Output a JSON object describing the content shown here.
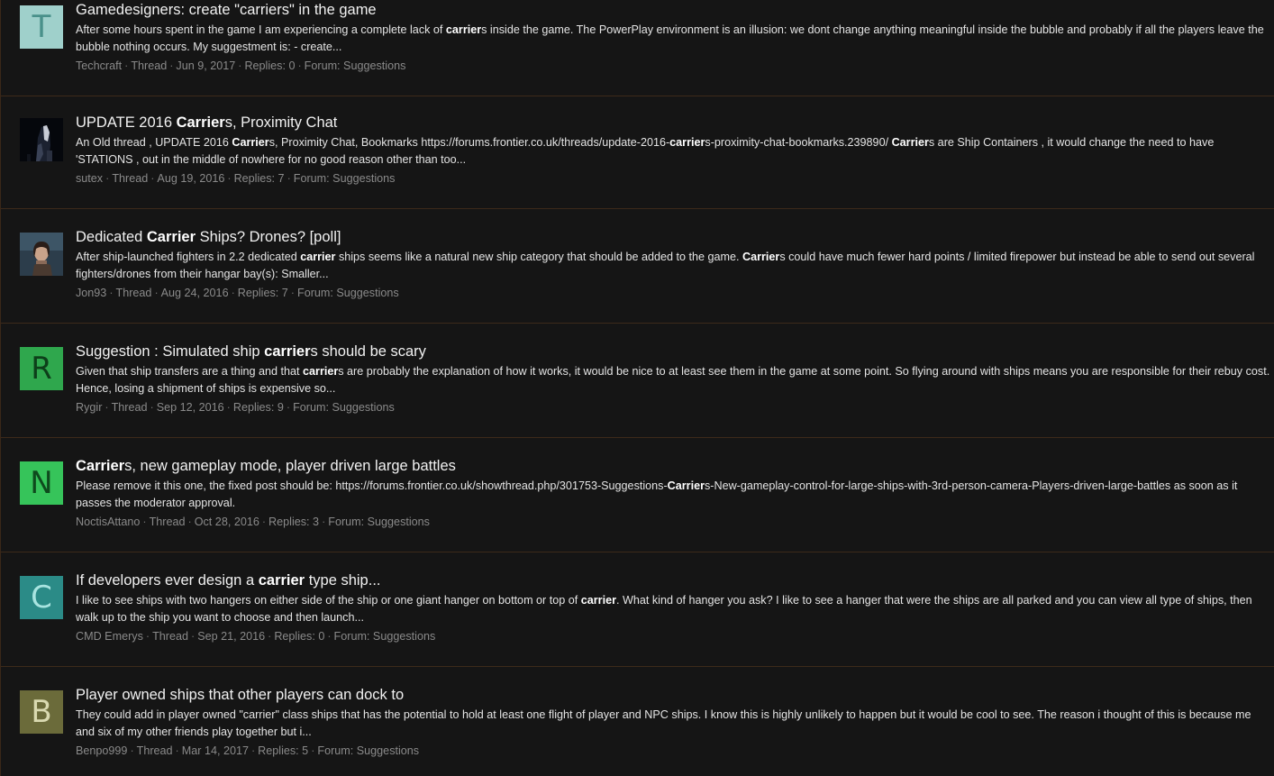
{
  "results": [
    {
      "avatar": {
        "type": "letter",
        "letter": "T",
        "bg": "#9fd0cb",
        "fg": "#49908a"
      },
      "title": [
        {
          "t": "Gamedesigners: create \"carriers\" in the game",
          "b": false
        }
      ],
      "snippet": [
        {
          "t": "After some hours spent in the game I am experiencing a complete lack of ",
          "b": false
        },
        {
          "t": "carrier",
          "b": true
        },
        {
          "t": "s inside the game. The PowerPlay environment is an illusion: we dont change anything meaningful inside the bubble and probably if all the players leave the bubble nothing occurs. My suggestment is: - create...",
          "b": false
        }
      ],
      "author": "Techcraft",
      "type": "Thread",
      "date": "Jun 9, 2017",
      "replies": "Replies: 0",
      "forum": "Forum: Suggestions"
    },
    {
      "avatar": {
        "type": "image",
        "name": "sutex-avatar",
        "bg": "#05070c"
      },
      "title": [
        {
          "t": "UPDATE 2016 ",
          "b": false
        },
        {
          "t": "Carrier",
          "b": true
        },
        {
          "t": "s, Proximity Chat",
          "b": false
        }
      ],
      "snippet": [
        {
          "t": "An Old thread , UPDATE 2016 ",
          "b": false
        },
        {
          "t": "Carrier",
          "b": true
        },
        {
          "t": "s, Proximity Chat, Bookmarks https://forums.frontier.co.uk/threads/update-2016-",
          "b": false
        },
        {
          "t": "carrier",
          "b": true
        },
        {
          "t": "s-proximity-chat-bookmarks.239890/ ",
          "b": false
        },
        {
          "t": "Carrier",
          "b": true
        },
        {
          "t": "s are Ship Containers , it would change the need to have 'STATIONS , out in the middle of nowhere for no good reason other than too...",
          "b": false
        }
      ],
      "author": "sutex",
      "type": "Thread",
      "date": "Aug 19, 2016",
      "replies": "Replies: 7",
      "forum": "Forum: Suggestions"
    },
    {
      "avatar": {
        "type": "image",
        "name": "jon93-avatar",
        "bg": "#2c3d4b"
      },
      "title": [
        {
          "t": "Dedicated ",
          "b": false
        },
        {
          "t": "Carrier",
          "b": true
        },
        {
          "t": " Ships? Drones? [poll]",
          "b": false
        }
      ],
      "snippet": [
        {
          "t": "After ship-launched fighters in 2.2 dedicated ",
          "b": false
        },
        {
          "t": "carrier",
          "b": true
        },
        {
          "t": " ships seems like a natural new ship category that should be added to the game. ",
          "b": false
        },
        {
          "t": "Carrier",
          "b": true
        },
        {
          "t": "s could have much fewer hard points / limited firepower but instead be able to send out several fighters/drones from their hangar bay(s): Smaller...",
          "b": false
        }
      ],
      "author": "Jon93",
      "type": "Thread",
      "date": "Aug 24, 2016",
      "replies": "Replies: 7",
      "forum": "Forum: Suggestions"
    },
    {
      "avatar": {
        "type": "letter",
        "letter": "R",
        "bg": "#2fa74d",
        "fg": "#0d3f1a"
      },
      "title": [
        {
          "t": "Suggestion : Simulated ship ",
          "b": false
        },
        {
          "t": "carrier",
          "b": true
        },
        {
          "t": "s should be scary",
          "b": false
        }
      ],
      "snippet": [
        {
          "t": "Given that ship transfers are a thing and that ",
          "b": false
        },
        {
          "t": "carrier",
          "b": true
        },
        {
          "t": "s are probably the explanation of how it works, it would be nice to at least see them in the game at some point. So flying around with ships means you are responsible for their rebuy cost. Hence, losing a shipment of ships is expensive so...",
          "b": false
        }
      ],
      "author": "Rygir",
      "type": "Thread",
      "date": "Sep 12, 2016",
      "replies": "Replies: 9",
      "forum": "Forum: Suggestions"
    },
    {
      "avatar": {
        "type": "letter",
        "letter": "N",
        "bg": "#36c45a",
        "fg": "#0e4a1d"
      },
      "title": [
        {
          "t": "Carrier",
          "b": true
        },
        {
          "t": "s, new gameplay mode, player driven large battles",
          "b": false
        }
      ],
      "snippet": [
        {
          "t": "Please remove it this one, the fixed post should be: https://forums.frontier.co.uk/showthread.php/301753-Suggestions-",
          "b": false
        },
        {
          "t": "Carrier",
          "b": true
        },
        {
          "t": "s-New-gameplay-control-for-large-ships-with-3rd-person-camera-Players-driven-large-battles as soon as it passes the moderator approval.",
          "b": false
        }
      ],
      "author": "NoctisAttano",
      "type": "Thread",
      "date": "Oct 28, 2016",
      "replies": "Replies: 3",
      "forum": "Forum: Suggestions"
    },
    {
      "avatar": {
        "type": "letter",
        "letter": "C",
        "bg": "#2b8b87",
        "fg": "#a8e4e0"
      },
      "title": [
        {
          "t": "If developers ever design a ",
          "b": false
        },
        {
          "t": "carrier",
          "b": true
        },
        {
          "t": " type ship...",
          "b": false
        }
      ],
      "snippet": [
        {
          "t": "I like to see ships with two hangers on either side of the ship or one giant hanger on bottom or top of ",
          "b": false
        },
        {
          "t": "carrier",
          "b": true
        },
        {
          "t": ". What kind of hanger you ask? I like to see a hanger that were the ships are all parked and you can view all type of ships, then walk up to the ship you want to choose and then launch...",
          "b": false
        }
      ],
      "author": "CMD Emerys",
      "type": "Thread",
      "date": "Sep 21, 2016",
      "replies": "Replies: 0",
      "forum": "Forum: Suggestions"
    },
    {
      "avatar": {
        "type": "letter",
        "letter": "B",
        "bg": "#6b6b3a",
        "fg": "#d9d9b0"
      },
      "title": [
        {
          "t": "Player owned ships that other players can dock to",
          "b": false
        }
      ],
      "snippet": [
        {
          "t": "They could add in player owned \"carrier\" class ships that has the potential to hold at least one flight of player and NPC ships. I know this is highly unlikely to happen but it would be cool to see. The reason i thought of this is because me and six of my other friends play together but i...",
          "b": false
        }
      ],
      "author": "Benpo999",
      "type": "Thread",
      "date": "Mar 14, 2017",
      "replies": "Replies: 5",
      "forum": "Forum: Suggestions"
    }
  ]
}
